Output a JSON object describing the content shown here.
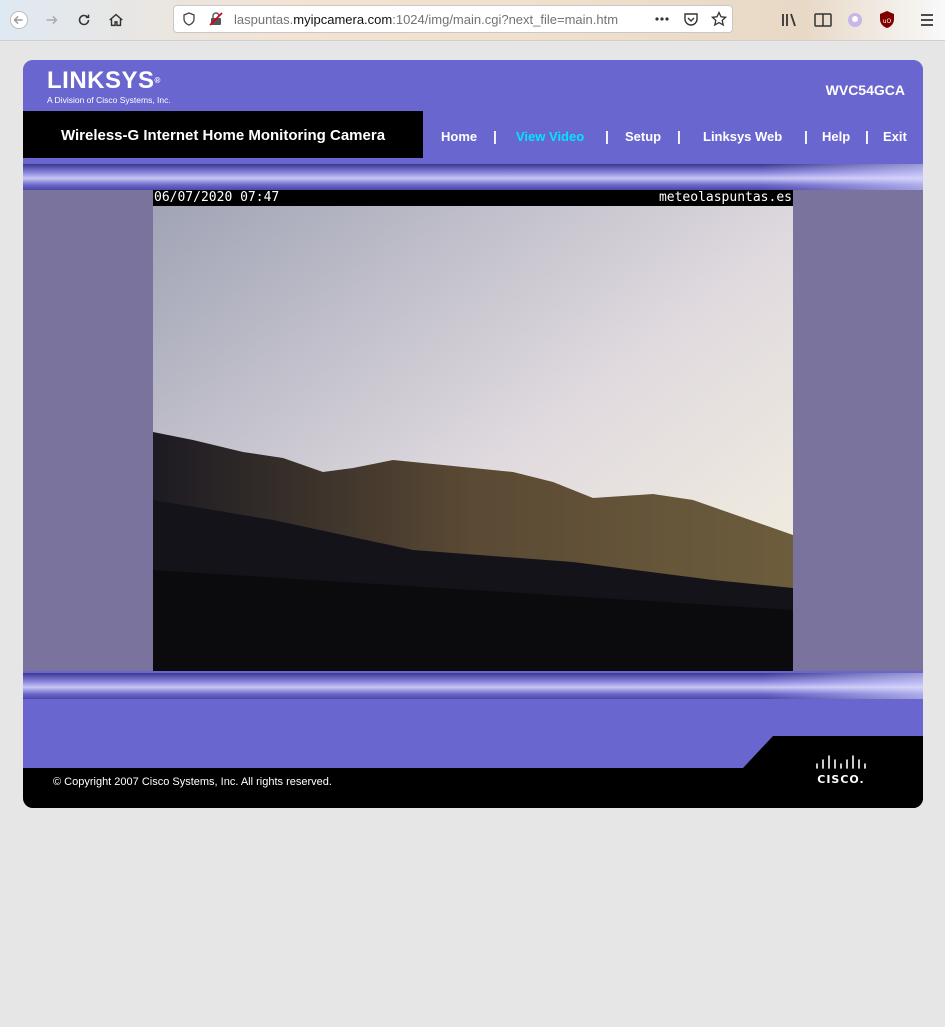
{
  "browser": {
    "url_prefix": "laspuntas.",
    "url_domain": "myipcamera.com",
    "url_suffix": ":1024/img/main.cgi?next_file=main.htm",
    "icons": [
      "back-icon",
      "forward-icon",
      "reload-icon",
      "home-icon",
      "shield-icon",
      "insecure-lock-icon",
      "more-icon",
      "pocket-icon",
      "star-icon",
      "library-icon",
      "reader-icon",
      "extension-icon",
      "ublock-icon",
      "menu-icon"
    ]
  },
  "header": {
    "brand": "LINKSYS",
    "brand_tm": "®",
    "brand_sub": "A Division of Cisco Systems, Inc.",
    "model": "WVC54GCA"
  },
  "title": "Wireless-G Internet Home Monitoring Camera",
  "menu": {
    "items": [
      {
        "label": "Home",
        "active": false
      },
      {
        "label": "View Video",
        "active": true
      },
      {
        "label": "Setup",
        "active": false
      },
      {
        "label": "Linksys Web",
        "active": false
      },
      {
        "label": "Help",
        "active": false
      },
      {
        "label": "Exit",
        "active": false
      }
    ],
    "separator": "|"
  },
  "video": {
    "timestamp": "06/07/2020 07:47",
    "watermark": "meteolaspuntas.es"
  },
  "footer": {
    "copyright": "© Copyright 2007 Cisco Systems, Inc. All rights reserved.",
    "cisco": "CISCO."
  },
  "colors": {
    "accent": "#6a66cf",
    "active_link": "#00e5ff"
  }
}
